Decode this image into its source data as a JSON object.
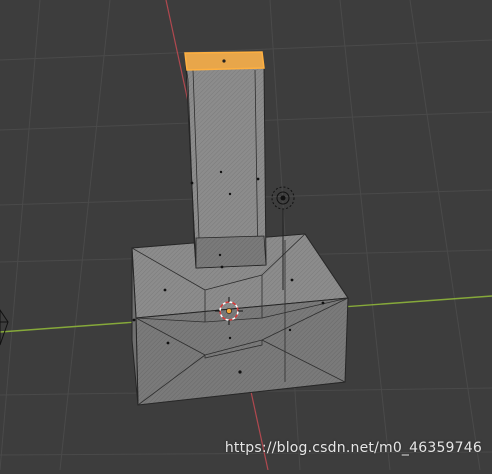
{
  "app": "3D Viewport",
  "colors": {
    "background": "#3d3d3d",
    "grid": "#4a4a4a",
    "axis_x": "#86a93a",
    "axis_y": "#b0484f",
    "mesh_fill": "#8a8a8a",
    "mesh_edge": "#262626",
    "selected_face": "#e8a64a",
    "selected_edge": "#ffb040"
  },
  "icons": {
    "object_origin": "origin-dot-icon",
    "cursor_3d": "3d-cursor-icon",
    "light": "light-icon",
    "camera": "camera-icon"
  },
  "watermark": {
    "text": "https://blog.csdn.net/m0_46359746"
  }
}
